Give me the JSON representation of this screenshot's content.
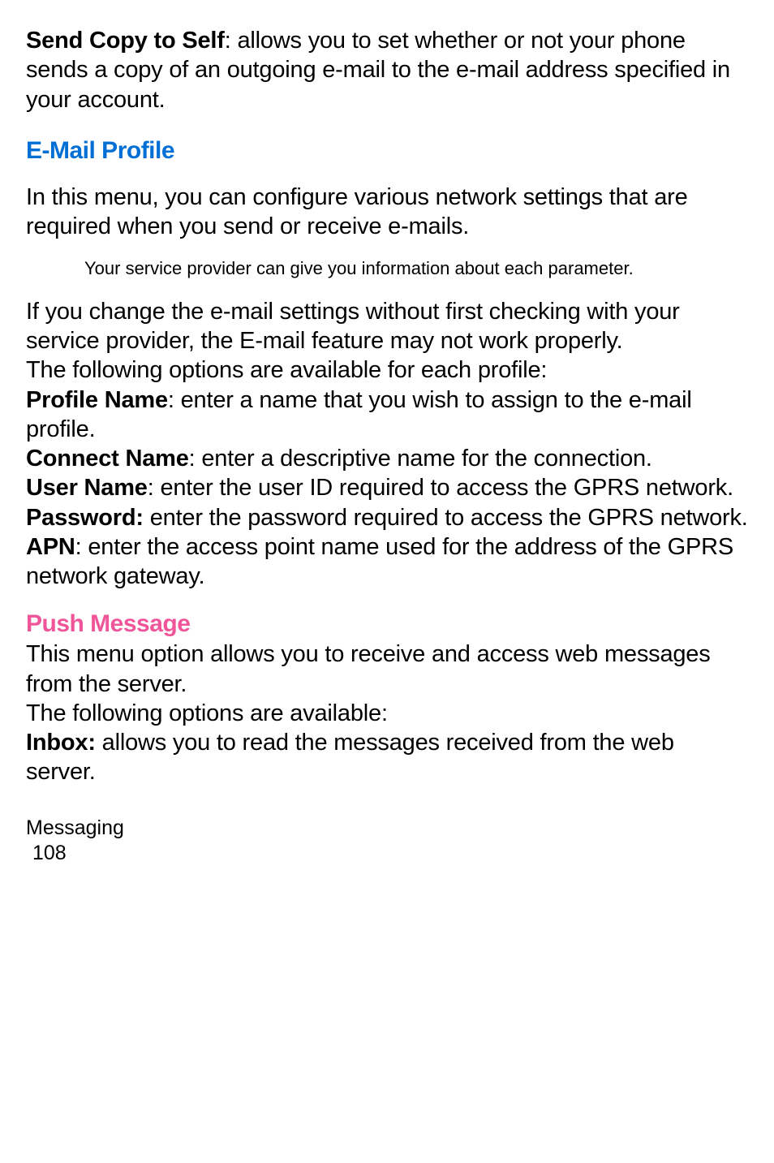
{
  "para1": {
    "bold": "Send Copy to Self",
    "text": ": allows you to set whether or not your phone sends a copy of an outgoing e-mail to the e-mail address specified in your account."
  },
  "heading1": "E-Mail Profile",
  "para2": "In this menu, you can configure various network settings that are required when you send or receive e-mails.",
  "note1": "Your service provider can give you information about each parameter.",
  "para3": "If you change the e-mail settings without first checking with your service provider, the E-mail feature may not work properly.",
  "para4": "The following options are available for each profile:",
  "para5": {
    "bold": "Profile Name",
    "text": ": enter a name that you wish to assign to the e-mail profile."
  },
  "para6": {
    "bold": "Connect Name",
    "text": ": enter a descriptive name for the connection."
  },
  "para7": {
    "bold": "User Name",
    "text": ": enter the user ID required to access the GPRS network."
  },
  "para8": {
    "bold": "Password:",
    "text": " enter the password required to access the GPRS network."
  },
  "para9": {
    "bold": "APN",
    "text": ": enter the access point name used for the address of the GPRS network gateway."
  },
  "heading2": "Push Message",
  "para10": "This menu option allows you to receive and access web messages from the server.",
  "para11": "The following options are available:",
  "para12": {
    "bold": "Inbox:",
    "text": " allows you to read the messages received from the web server."
  },
  "footer": {
    "section": "Messaging",
    "page": "108"
  }
}
